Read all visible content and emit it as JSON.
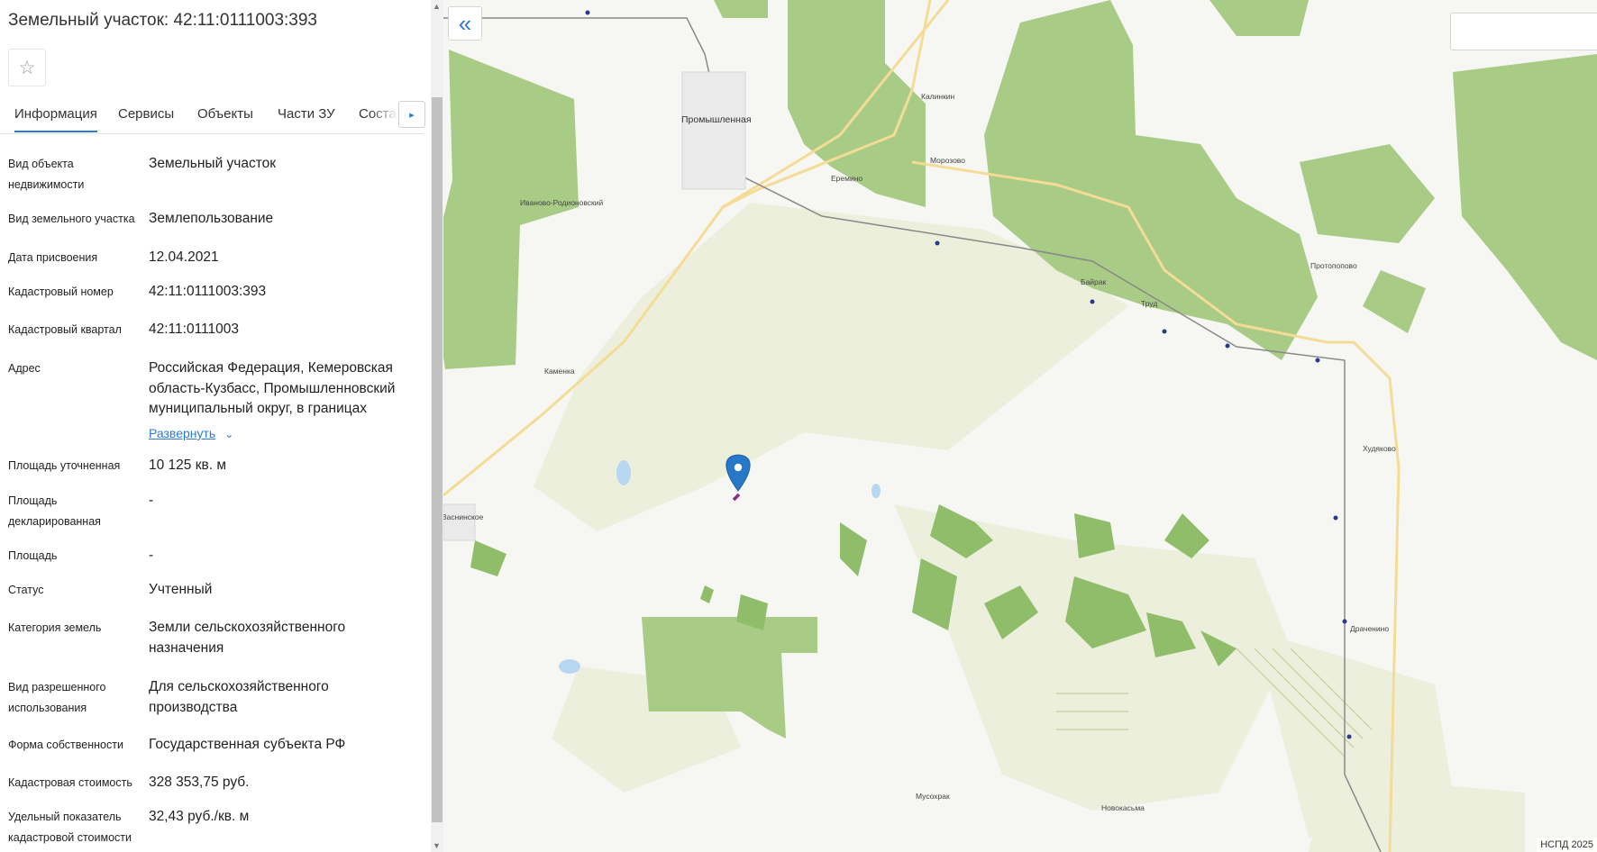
{
  "panel": {
    "title": "Земельный участок: 42:11:0111003:393",
    "star_icon": "☆",
    "tabs": [
      "Информация",
      "Сервисы",
      "Объекты",
      "Части ЗУ",
      "Состав"
    ],
    "tabs_next_icon": "▸",
    "fields": [
      {
        "label": "Вид объекта недвижимости",
        "value": "Земельный участок"
      },
      {
        "label": "Вид земельного участка",
        "value": "Землепользование"
      },
      {
        "label": "Дата присвоения",
        "value": "12.04.2021"
      },
      {
        "label": "Кадастровый номер",
        "value": "42:11:0111003:393"
      },
      {
        "label": "Кадастровый квартал",
        "value": "42:11:0111003"
      },
      {
        "label": "Адрес",
        "value": "Российская Федерация, Кемеровская область-Кузбасс, Промышленновский муниципальный округ, в границах"
      },
      {
        "label": "Площадь уточненная",
        "value": "10 125 кв. м"
      },
      {
        "label": "Площадь декларированная",
        "value": "-"
      },
      {
        "label": "Площадь",
        "value": "-"
      },
      {
        "label": "Статус",
        "value": "Учтенный"
      },
      {
        "label": "Категория земель",
        "value": "Земли сельскохозяйственного назначения"
      },
      {
        "label": "Вид разрешенного использования",
        "value": "Для сельскохозяйственного производства"
      },
      {
        "label": "Форма собственности",
        "value": "Государственная субъекта РФ"
      },
      {
        "label": "Кадастровая стоимость",
        "value": "328 353,75 руб."
      },
      {
        "label": "Удельный показатель кадастровой стоимости",
        "value": "32,43 руб./кв. м"
      }
    ],
    "expand_label": "Развернуть",
    "expand_icon": "⌄"
  },
  "map": {
    "collapse_icon": "«",
    "copyright": "НСПД 2025",
    "places": [
      "Промышленная",
      "Калинкин",
      "Морозово",
      "Еремино",
      "Иваново-Родионовский",
      "Байрак",
      "Протопопово",
      "Труд",
      "Каменка",
      "Васнинское",
      "Худяково",
      "Драченино",
      "Мусохрак",
      "Новокасьма"
    ],
    "colors": {
      "forest": "#a8cb86",
      "field": "#ecefdc",
      "water": "#b8d8f2",
      "road": "#f5dc96",
      "rail": "#888888",
      "marker": "#2878c8",
      "parcel": "#8a2a8a"
    }
  }
}
